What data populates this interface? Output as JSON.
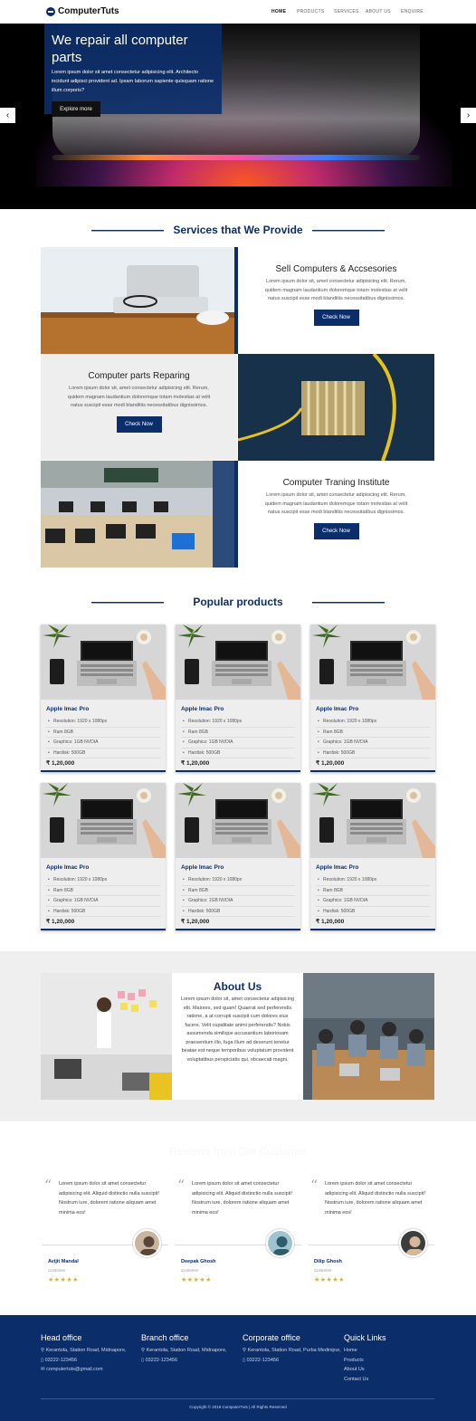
{
  "brand": {
    "name": "ComputerTuts"
  },
  "nav": {
    "items": [
      "HOME",
      "PRODUCTS",
      "SERVICES",
      "ABOUT US",
      "ENQUIRE"
    ]
  },
  "hero": {
    "title": "We repair all computer parts",
    "text": "Lorem ipsum dolor sit amet consectetur adipisicing elit. Architecto incidunt adipisci provident ad. Ipsam laborum sapiente quisquam ratione illum corporis?",
    "button": "Explore more"
  },
  "services": {
    "title": "Services that We Provide",
    "items": [
      {
        "title": "Sell Computers & Accsesories",
        "text": "Lorem ipsum dolor sit, amet consectetur adipisicing elit. Rerum, quidem magnam laudantium doloremque totam molestias at velit natus suscipit esse modi blanditiis necessitatibus dignissimos.",
        "button": "Check Now"
      },
      {
        "title": "Computer parts Reparing",
        "text": "Lorem ipsum dolor sit, amet consectetur adipisicing elit. Rerum, quidem magnam laudantium doloremque totam molestias at velit natus suscipit esse modi blanditiis necessitatibus dignissimos.",
        "button": "Check Now"
      },
      {
        "title": "Computer Traning Institute",
        "text": "Lorem ipsum dolor sit, amet consectetur adipisicing elit. Rerum, quidem magnam laudantium doloremque totam molestias at velit natus suscipit esse modi blanditiis necessitatibus dignissimos.",
        "button": "Check Now"
      }
    ]
  },
  "products": {
    "title": "Popular products",
    "items": [
      {
        "name": "Apple Imac Pro",
        "specs": [
          "Resolution: 1920 x 1080px",
          "Ram 8GB",
          "Graphics: 1GB NVDIA",
          "Hardisk: 500GB"
        ],
        "price": "₹ 1,20,000"
      },
      {
        "name": "Apple Imac Pro",
        "specs": [
          "Resolution: 1920 x 1080px",
          "Ram 8GB",
          "Graphics: 1GB NVDIA",
          "Hardisk: 500GB"
        ],
        "price": "₹ 1,20,000"
      },
      {
        "name": "Apple Imac Pro",
        "specs": [
          "Resolution: 1920 x 1080px",
          "Ram 8GB",
          "Graphics: 1GB NVDIA",
          "Hardisk: 500GB"
        ],
        "price": "₹ 1,20,000"
      },
      {
        "name": "Apple Imac Pro",
        "specs": [
          "Resolution: 1920 x 1080px",
          "Ram 8GB",
          "Graphics: 1GB NVDIA",
          "Hardisk: 500GB"
        ],
        "price": "₹ 1,20,000"
      },
      {
        "name": "Apple Imac Pro",
        "specs": [
          "Resolution: 1920 x 1080px",
          "Ram 8GB",
          "Graphics: 1GB NVDIA",
          "Hardisk: 500GB"
        ],
        "price": "₹ 1,20,000"
      },
      {
        "name": "Apple Imac Pro",
        "specs": [
          "Resolution: 1920 x 1080px",
          "Ram 8GB",
          "Graphics: 1GB NVDIA",
          "Hardisk: 500GB"
        ],
        "price": "₹ 1,20,000"
      }
    ]
  },
  "about": {
    "title": "About Us",
    "text": "Lorem ipsum dolor sit, amet consectetur adipisicing elit. Maiores, sed quam! Quaerat sed perferendis ratione, a at corrupti suscipit cum dolores eius facere. Velit cupiditate animi perferendis? Nobis assumenda similique accusantium laboriosam praesentium illo, fuga illum ad deserunt tenetur beatae est neque temporibus voluptatum provident voluptatibus perspiciatis qui, obcaecati magni."
  },
  "reviews": {
    "title": "Reviews from Our Customer",
    "items": [
      {
        "text": "Lorem ipsum dolor sit amet consectetur adipisicing elit. Aliquid distinctio nulla suscipit! Nostrum iure, dolorem ratione aliquam amet minima eos!",
        "name": "Avijit Mandal",
        "role": "Customer",
        "stars": "★★★★★"
      },
      {
        "text": "Lorem ipsum dolor sit amet consectetur adipisicing elit. Aliquid distinctio nulla suscipit! Nostrum iure, dolorem ratione aliquam amet minima eos!",
        "name": "Deepak Ghosh",
        "role": "Customer",
        "stars": "★★★★★"
      },
      {
        "text": "Lorem ipsum dolor sit amet consectetur adipisicing elit. Aliquid distinctio nulla suscipit! Nostrum iure, dolorem ratione aliquam amet minima eos!",
        "name": "Dilip Ghosh",
        "role": "Customer",
        "stars": "★★★★★"
      }
    ]
  },
  "footer": {
    "head_office": {
      "title": "Head office",
      "address": "Kerantola, Station Road, Midnapore,",
      "phone": "03222-123456",
      "email": "computertuts@gmail.com"
    },
    "branch_office": {
      "title": "Branch office",
      "address": "Kerantola, Station Road, Midnapore,",
      "phone": "03222-123456"
    },
    "corporate_office": {
      "title": "Corporate office",
      "address": "Kerantola, Station Road, Purba Medinipur,",
      "phone": "03222-123456"
    },
    "quick_links": {
      "title": "Quick Links",
      "items": [
        "Home",
        "Products",
        "About Us",
        "Contact Us"
      ]
    },
    "copyright": "Copyright © 2019 ComputerTuts | All Rights Reserved"
  },
  "colors": {
    "primary": "#0b2e6b",
    "star": "#e0b21b"
  }
}
